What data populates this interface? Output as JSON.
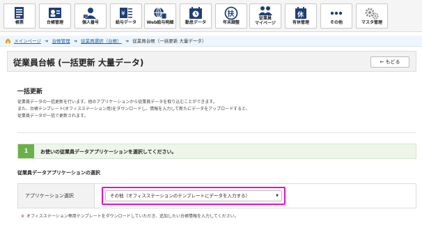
{
  "toolbar": {
    "items": [
      {
        "label": "帳票",
        "icon": "document-list-icon"
      },
      {
        "label": "台帳管理",
        "icon": "person-card-icon"
      },
      {
        "label": "個人番号",
        "icon": "my-number-icon"
      },
      {
        "label": "給与データ",
        "icon": "salary-data-icon"
      },
      {
        "label": "Web給与明細",
        "icon": "web-payslip-icon"
      },
      {
        "label": "勤怠データ",
        "icon": "attendance-icon"
      },
      {
        "label": "年末調整",
        "icon": "year-end-icon"
      },
      {
        "label": "従業員\nマイページ",
        "icon": "employee-mypage-icon"
      },
      {
        "label": "有休管理",
        "icon": "paid-leave-icon"
      },
      {
        "label": "その他",
        "icon": "more-dots-icon"
      },
      {
        "label": "マスタ管理",
        "icon": "gears-icon"
      }
    ]
  },
  "breadcrumb": {
    "items": [
      "メインページ",
      "台帳管理",
      "従業員選択（台帳）",
      "従業員台帳（一括更新 大量データ）"
    ]
  },
  "header": {
    "title": "従業員台帳 (一括更新 大量データ)",
    "back_label": "← もどる"
  },
  "section": {
    "title": "一括更新",
    "description": [
      "従業員データの一括更新を行います。他のアプリケーションから従業員データを取り込むことができます。",
      "また、台帳テンプレート(オフィスステーション用)をダウンロードし、情報を入力して新たにデータをアップロードすると、",
      "従業員データが一括で更新されます。"
    ]
  },
  "step": {
    "number": "1",
    "text": "お使いの従業員データアプリケーションを選択してください。"
  },
  "form": {
    "subtitle": "従業員データアプリケーションの選択",
    "field_label": "アプリケーション選択",
    "selected_value": "その他（オフィスステーションのテンプレートにデータを入力する）",
    "note_mark": "※",
    "note": "オフィスステーション専用テンプレートをダウンロードしていただき、追加したい台帳情報を入力してください。"
  },
  "colors": {
    "accent": "#1d62a8",
    "step_green": "#6bb04a",
    "highlight_magenta": "#e010c8"
  }
}
